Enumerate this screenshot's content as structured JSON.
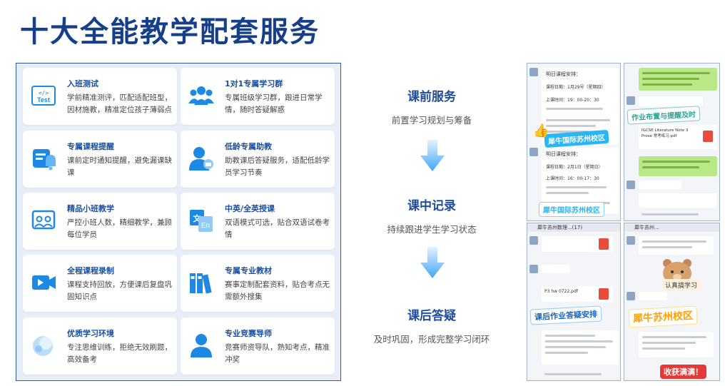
{
  "page_title": "十大全能教学配套服务",
  "services": [
    {
      "title": "入班测试",
      "desc": "学前精准测评，匹配适配班型，因材施教，精准定位孩子薄弱点",
      "icon": "test-icon"
    },
    {
      "title": "1对1专属学习群",
      "desc": "专属班级学习群，跟进日常学情，随时答疑解惑",
      "icon": "group-icon"
    },
    {
      "title": "专属课程提醒",
      "desc": "课前定时通知提醒，避免漏课缺课",
      "icon": "bell-icon"
    },
    {
      "title": "低龄专属助教",
      "desc": "助教课后答疑服务，适配低龄学员学习节奏",
      "icon": "assistant-icon"
    },
    {
      "title": "精品小班教学",
      "desc": "严控小班人数，精细教学，兼顾每位学员",
      "icon": "small-class-icon"
    },
    {
      "title": "中英/全英授课",
      "desc": "双语模式可选，贴合双语试卷考情",
      "icon": "language-icon"
    },
    {
      "title": "全程课程录制",
      "desc": "课程支持回放，方便课后复盘巩固知识点",
      "icon": "video-icon"
    },
    {
      "title": "专属专业教材",
      "desc": "赛事定制配套资料，贴合考点无需额外搜集",
      "icon": "books-icon"
    },
    {
      "title": "优质学习环境",
      "desc": "专注思维训练，拒绝无效刷题，高效备考",
      "icon": "environment-icon"
    },
    {
      "title": "专业竞赛导师",
      "desc": "竞赛师资导队，熟知考点，精准冲奖",
      "icon": "mentor-icon"
    }
  ],
  "steps": [
    {
      "title": "课前服务",
      "subtitle": "前置学习规划与筹备"
    },
    {
      "title": "课中记录",
      "subtitle": "持续跟进学生学习状态"
    },
    {
      "title": "课后答疑",
      "subtitle": "及时巩固，形成完整学习闭环"
    }
  ],
  "screenshots": {
    "s1_text1": "明日课程安排：",
    "s1_text2": "课程日期：1月29号（星期四）",
    "s1_text3": "上课时间：19：00-20：30",
    "s1_text4": "明日课程安排：",
    "s1_text5": "课程日期：2月1日（星期日）",
    "s1_text6": "上课时间：16：00-17：30",
    "s1_banner": "犀牛国际苏州校区",
    "s2_banner": "作业布置与提醒及时",
    "s2_file": "IGCSE Literature Note 3 Prose 常考练习.pdf",
    "s3_banner": "课后作业答疑安排",
    "s3_file1": "P3 hw 0722.pdf",
    "s3_title": "犀牛苏州数理...(17)",
    "s4_banner": "犀牛苏州校区",
    "s4_sticker": "认真搞学习",
    "s4_tag": "收获满满！",
    "s4_title": "犀牛苏州..."
  }
}
